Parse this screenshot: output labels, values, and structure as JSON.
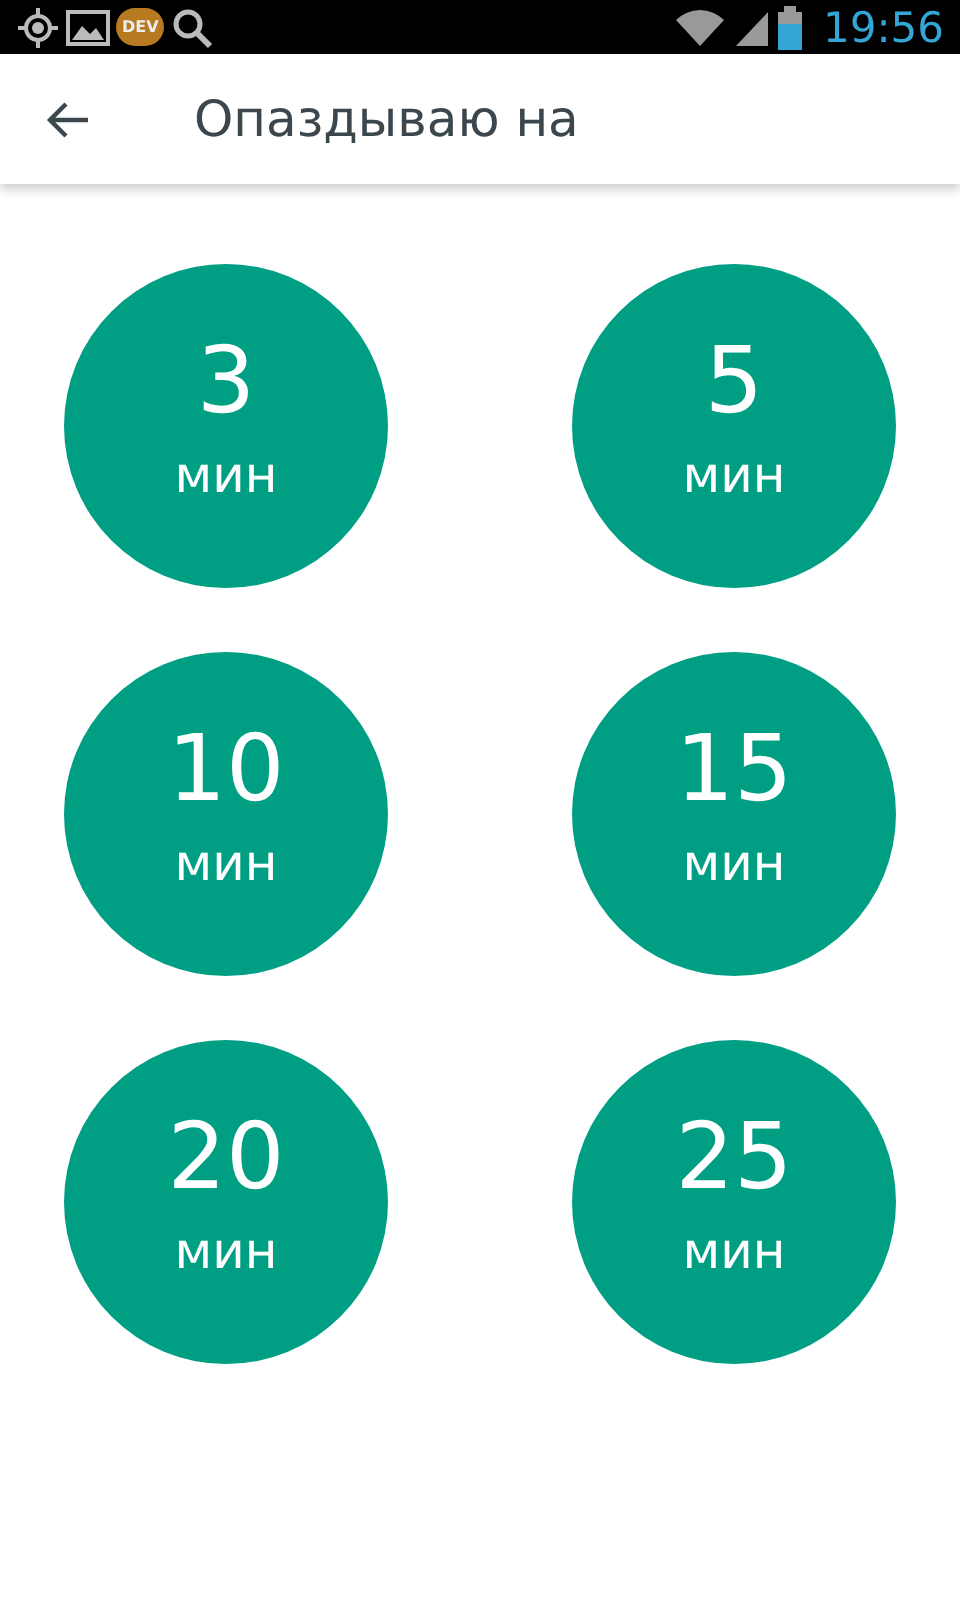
{
  "status_bar": {
    "badge": "DEV",
    "time": "19:56"
  },
  "app_bar": {
    "title": "Опаздываю на"
  },
  "options": [
    {
      "value": "3",
      "unit": "мин"
    },
    {
      "value": "5",
      "unit": "мин"
    },
    {
      "value": "10",
      "unit": "мин"
    },
    {
      "value": "15",
      "unit": "мин"
    },
    {
      "value": "20",
      "unit": "мин"
    },
    {
      "value": "25",
      "unit": "мин"
    }
  ]
}
